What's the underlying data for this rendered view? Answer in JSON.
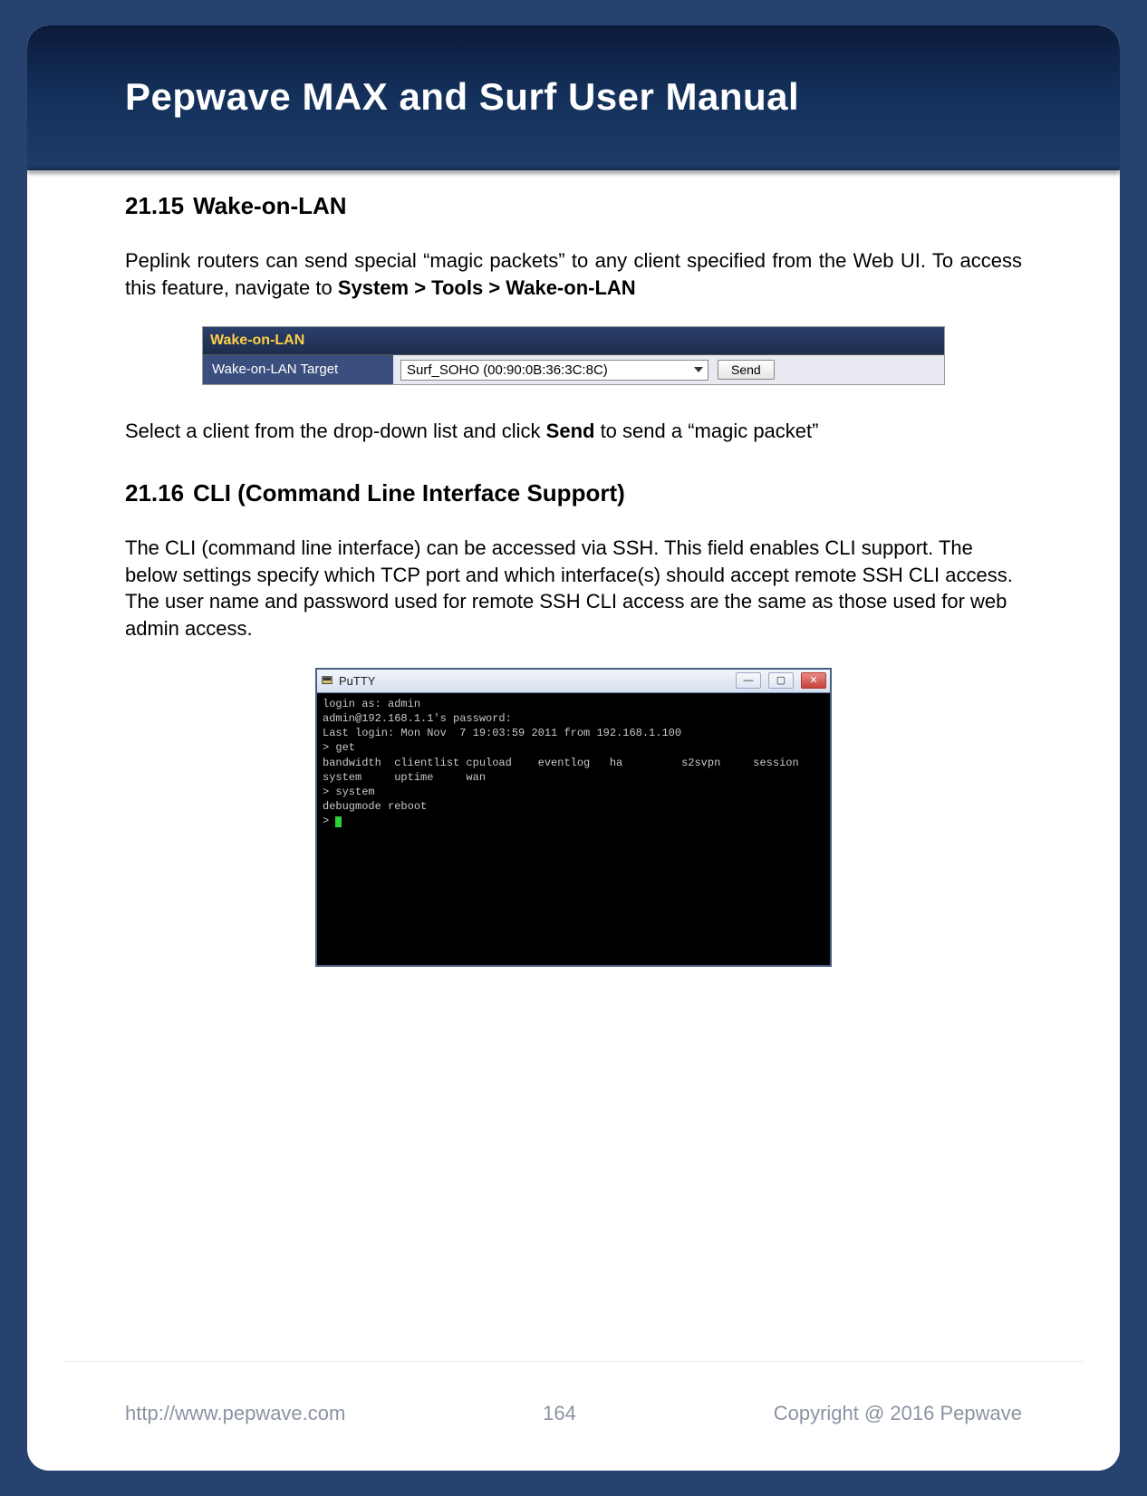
{
  "doc": {
    "title": "Pepwave MAX and Surf User Manual"
  },
  "section1": {
    "number": "21.15",
    "title": "Wake-on-LAN",
    "intro_a": "Peplink routers can send special “magic packets” to any client specified from the Web UI. To access this feature, navigate to ",
    "nav_path": "System > Tools > Wake-on-LAN",
    "panel": {
      "header": "Wake-on-LAN",
      "row_label": "Wake-on-LAN Target",
      "select_value": "Surf_SOHO (00:90:0B:36:3C:8C)",
      "send_label": "Send"
    },
    "after_panel_pre": "Select a client from the drop-down list and click ",
    "after_panel_bold": "Send",
    "after_panel_post": " to send a “magic packet”"
  },
  "section2": {
    "number": "21.16",
    "title": "CLI (Command Line Interface Support)",
    "body": "The CLI (command line interface) can be accessed via SSH. This field enables CLI support. The below settings specify which TCP port and which interface(s) should accept remote SSH CLI access. The user name and password used for remote SSH CLI access are the same as those used for web admin access."
  },
  "putty": {
    "title": "PuTTY",
    "lines": "login as: admin\nadmin@192.168.1.1's password:\nLast login: Mon Nov  7 19:03:59 2011 from 192.168.1.100\n> get\nbandwidth  clientlist cpuload    eventlog   ha         s2svpn     session\nsystem     uptime     wan\n> system\ndebugmode reboot\n> "
  },
  "footer": {
    "url": "http://www.pepwave.com",
    "page": "164",
    "copyright": "Copyright @ 2016 Pepwave"
  }
}
